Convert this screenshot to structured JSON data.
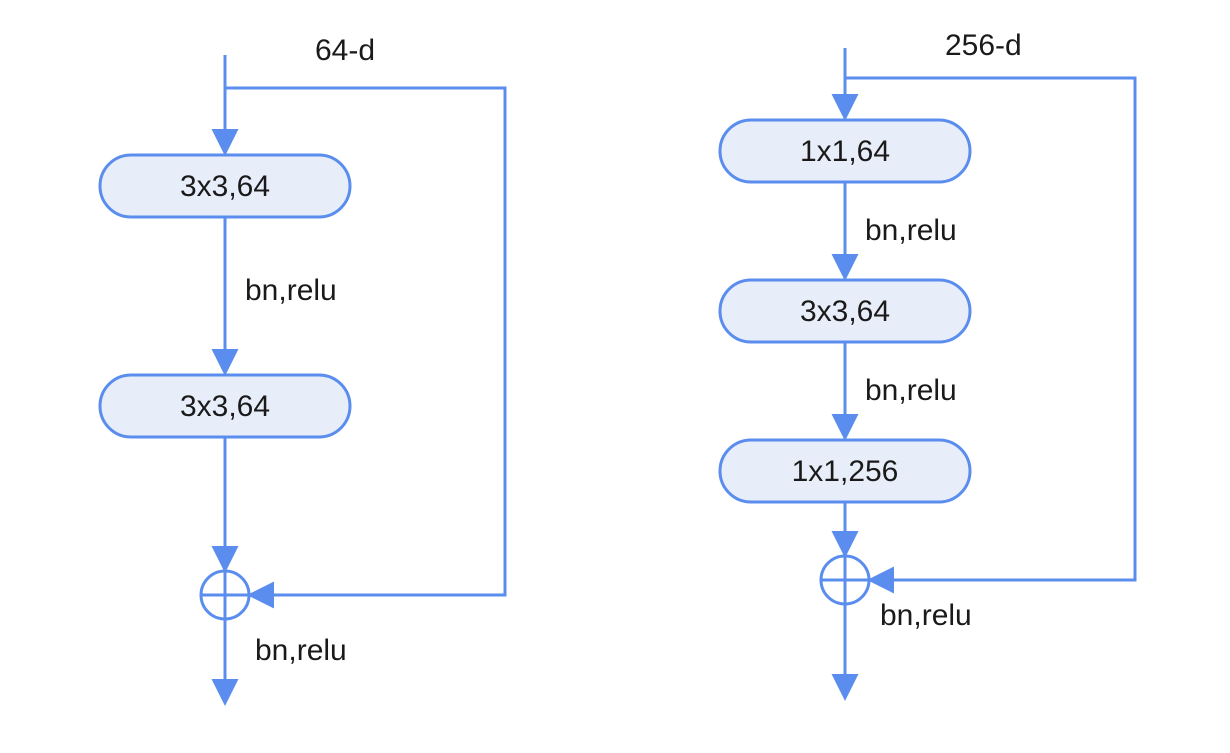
{
  "left": {
    "top_label": "64-d",
    "block1": "3x3,64",
    "edge1_label": "bn,relu",
    "block2": "3x3,64",
    "bottom_label": "bn,relu"
  },
  "right": {
    "top_label": "256-d",
    "block1": "1x1,64",
    "edge1_label": "bn,relu",
    "block2": "3x3,64",
    "edge2_label": "bn,relu",
    "block3": "1x1,256",
    "bottom_label": "bn,relu"
  },
  "colors": {
    "stroke": "#5a8dee",
    "block_fill": "#e8eef9",
    "text": "#1a1a1a"
  }
}
